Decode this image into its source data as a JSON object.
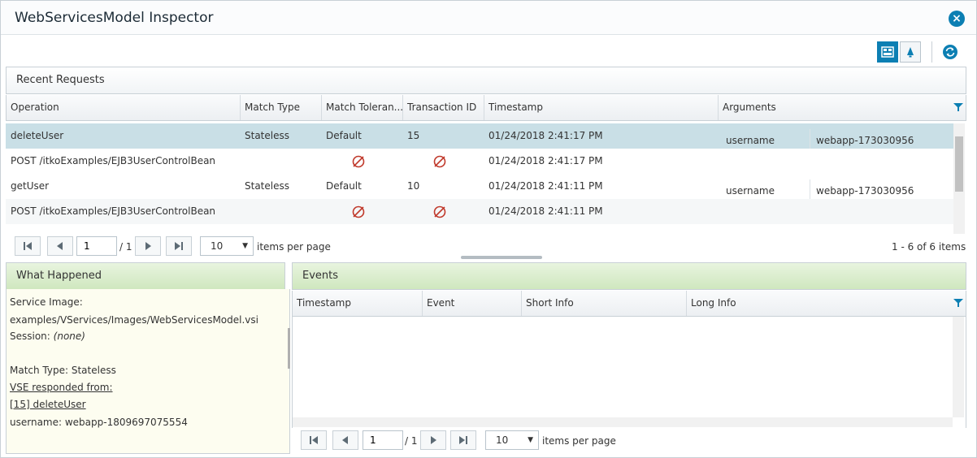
{
  "window": {
    "title": "WebServicesModel Inspector",
    "close_glyph": "×"
  },
  "toolbar": {
    "buttons": [
      {
        "icon": "grid-view-icon",
        "active": true
      },
      {
        "icon": "bell-icon",
        "active": false
      },
      {
        "icon": "refresh-icon",
        "active": false
      }
    ]
  },
  "recent_requests": {
    "title": "Recent Requests",
    "columns": [
      "Operation",
      "Match Type",
      "Match Toleran...",
      "Transaction ID",
      "Timestamp",
      "Arguments"
    ],
    "rows": [
      {
        "operation": "deleteUser",
        "match_type": "Stateless",
        "match_tolerance": "Default",
        "transaction_id": "15",
        "timestamp": "01/24/2018 2:41:17 PM",
        "arg_name": "username",
        "arg_value": "webapp-173030956",
        "selected": true,
        "tolerance_null": false,
        "txn_null": false
      },
      {
        "operation": "POST /itkoExamples/EJB3UserControlBean",
        "match_type": "",
        "match_tolerance": "",
        "transaction_id": "",
        "timestamp": "01/24/2018 2:41:17 PM",
        "arg_name": "",
        "arg_value": "",
        "selected": false,
        "tolerance_null": true,
        "txn_null": true
      },
      {
        "operation": "getUser",
        "match_type": "Stateless",
        "match_tolerance": "Default",
        "transaction_id": "10",
        "timestamp": "01/24/2018 2:41:11 PM",
        "arg_name": "username",
        "arg_value": "webapp-173030956",
        "selected": false,
        "tolerance_null": false,
        "txn_null": false
      },
      {
        "operation": "POST /itkoExamples/EJB3UserControlBean",
        "match_type": "",
        "match_tolerance": "",
        "transaction_id": "",
        "timestamp": "01/24/2018 2:41:11 PM",
        "arg_name": "",
        "arg_value": "",
        "selected": false,
        "tolerance_null": true,
        "txn_null": true
      }
    ],
    "pager": {
      "page": "1",
      "of_text": "/ 1",
      "page_size": "10",
      "items_per_page": "items per page",
      "summary": "1 - 6 of 6 items"
    }
  },
  "what_happened": {
    "title": "What Happened",
    "service_image_label": "Service Image:",
    "service_image_value": "examples/VServices/Images/WebServicesModel.vsi",
    "session_label": "Session:",
    "session_value": "(none)",
    "match_type_line": "Match Type: Stateless",
    "vse_responded": "VSE responded from:",
    "responded_item": "[15] deleteUser",
    "username_line": "username:  webapp-1809697075554"
  },
  "events": {
    "title": "Events",
    "columns": [
      "Timestamp",
      "Event",
      "Short Info",
      "Long Info"
    ],
    "pager": {
      "page": "1",
      "of_text": "/ 1",
      "page_size": "10",
      "items_per_page": "items per page"
    }
  }
}
